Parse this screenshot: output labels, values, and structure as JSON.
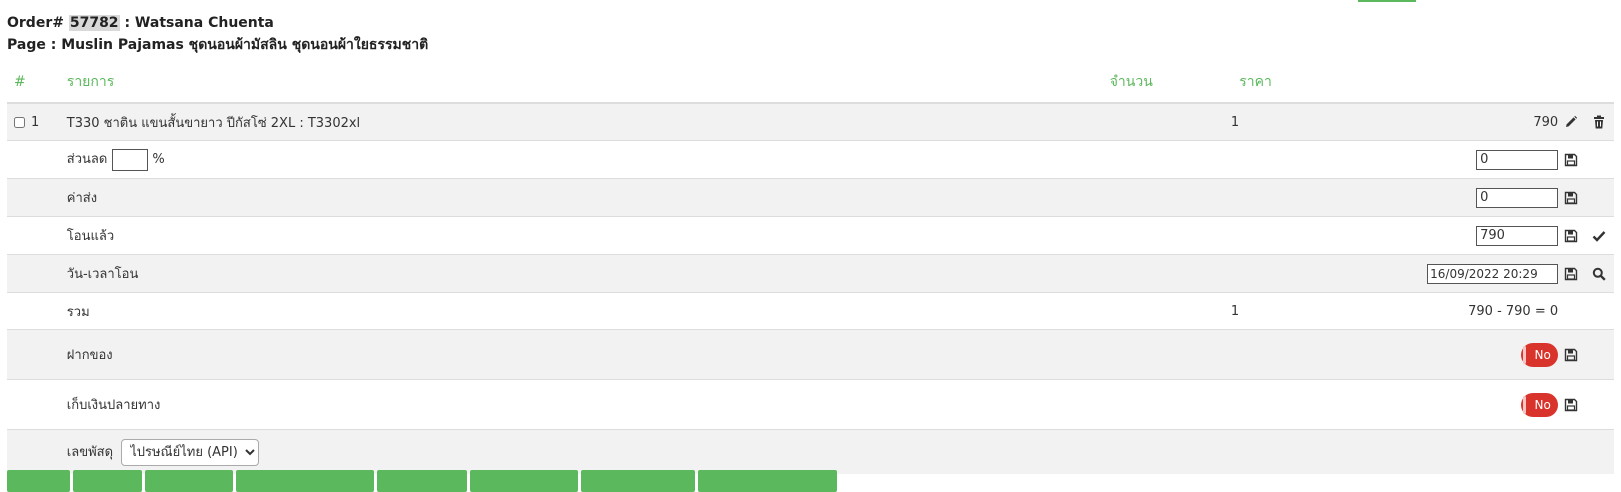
{
  "header": {
    "order_prefix": "Order#",
    "order_number": "57782",
    "customer_sep": ":",
    "customer_name": "Watsana Chuenta",
    "page_line": "Page : Muslin Pajamas ชุดนอนผ้ามัสลิน ชุดนอนผ้าใยธรรมชาติ"
  },
  "table": {
    "columns": {
      "num": "#",
      "item": "รายการ",
      "qty": "จำนวน",
      "price": "ราคา"
    },
    "item_row": {
      "index": "1",
      "name": "T330 ชาติน แขนสั้นขายาว ปีกัสโซ่ 2XL : T3302xl",
      "qty": "1",
      "price": "790"
    },
    "discount": {
      "label": "ส่วนลด",
      "percent_value": "",
      "percent_sign": "%",
      "amount": "0"
    },
    "shipping": {
      "label": "ค่าส่ง",
      "amount": "0"
    },
    "transferred": {
      "label": "โอนแล้ว",
      "amount": "790"
    },
    "transfer_time": {
      "label": "วัน-เวลาโอน",
      "value": "16/09/2022 20:29"
    },
    "total": {
      "label": "รวม",
      "qty": "1",
      "value": "790 - 790 = 0"
    },
    "deposit": {
      "label": "ฝากของ",
      "toggle": "No",
      "on": false
    },
    "cod": {
      "label": "เก็บเงินปลายทาง",
      "toggle": "No",
      "on": false
    },
    "tracking": {
      "label": "เลขพัสดุ",
      "selected": "ไปรษณีย์ไทย (API)"
    }
  },
  "icons": {
    "edit": "pencil-icon",
    "delete": "trash-icon",
    "save": "floppy-disk-icon",
    "confirm": "checkmark-icon",
    "search": "search-icon"
  },
  "colors": {
    "accent": "#5cb85c",
    "toggle_off": "#d9342b",
    "row_alt": "#f2f2f2"
  }
}
